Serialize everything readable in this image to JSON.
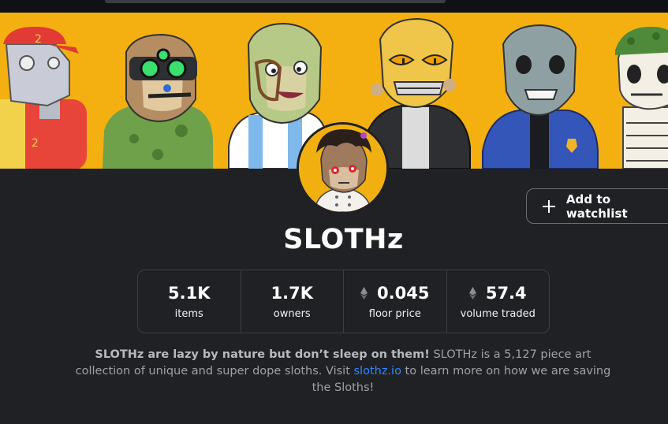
{
  "collection": {
    "name": "SLOTHz",
    "watchlist_label": "Add to watchlist"
  },
  "stats": [
    {
      "value": "5.1K",
      "label": "items",
      "eth": false
    },
    {
      "value": "1.7K",
      "label": "owners",
      "eth": false
    },
    {
      "value": "0.045",
      "label": "floor price",
      "eth": true
    },
    {
      "value": "57.4",
      "label": "volume traded",
      "eth": true
    }
  ],
  "description": {
    "bold": "SLOTHz are lazy by nature but don’t sleep on them!",
    "text1": " SLOTHz is a 5,127 piece art collection of unique and super dope sloths. Visit ",
    "link": "slothz.io",
    "text2": " to learn more on how we are saving the Sloths!"
  },
  "colors": {
    "banner": "#f4b011",
    "background": "#202124",
    "link": "#2f86ff"
  },
  "icons": {
    "watchlist": "plus-icon",
    "currency": "ethereum-icon"
  }
}
